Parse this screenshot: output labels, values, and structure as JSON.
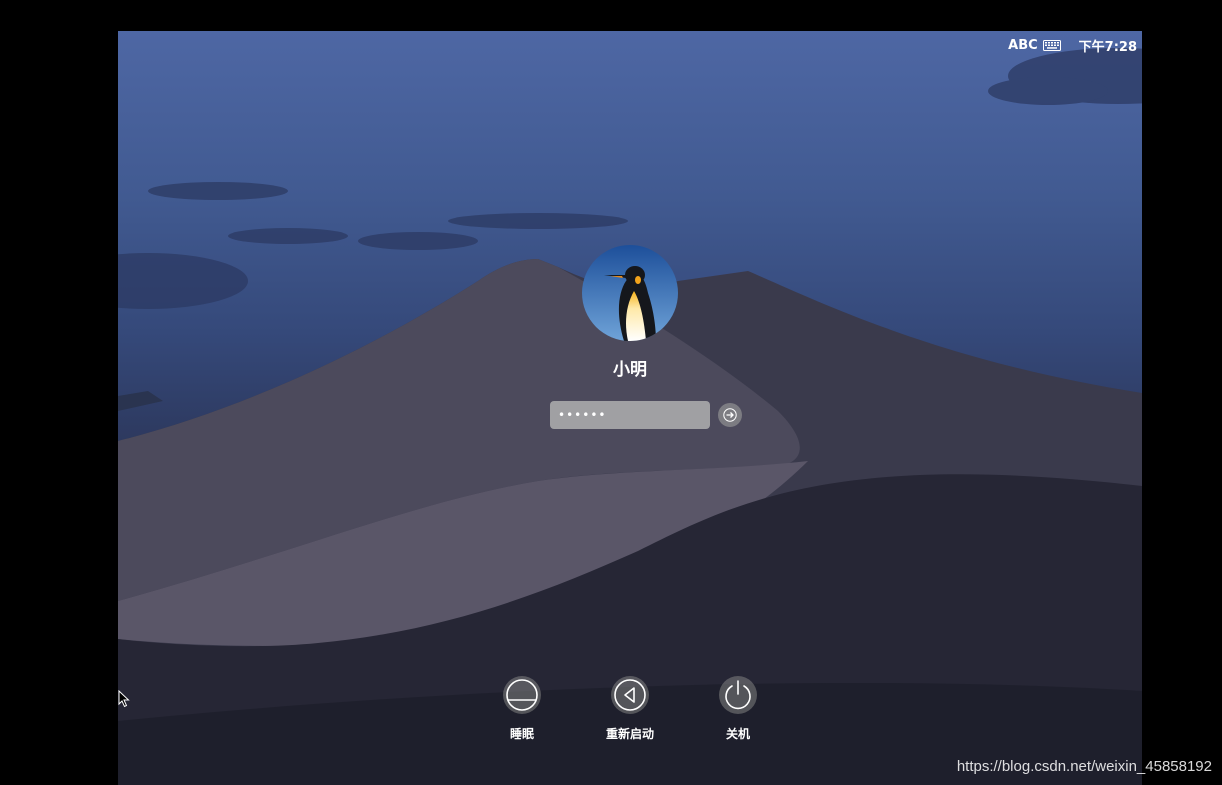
{
  "menubar": {
    "input_method": "ABC",
    "time": "下午7:28"
  },
  "user": {
    "name": "小明",
    "password_value": "••••••"
  },
  "actions": [
    {
      "label": "睡眠",
      "icon": "sleep-icon"
    },
    {
      "label": "重新启动",
      "icon": "restart-icon"
    },
    {
      "label": "关机",
      "icon": "shutdown-icon"
    }
  ],
  "watermark": "https://blog.csdn.net/weixin_45858192"
}
